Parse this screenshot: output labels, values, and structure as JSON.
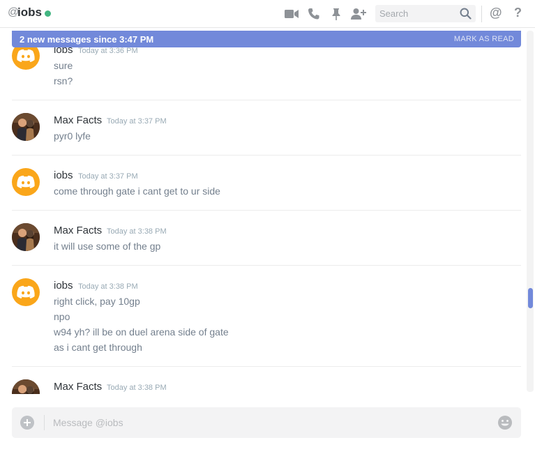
{
  "header": {
    "at_symbol": "@",
    "channel_name": "iobs",
    "status_color": "#43b581",
    "icons": [
      "video-call-icon",
      "voice-call-icon",
      "pin-icon",
      "add-friend-icon",
      "mention-icon",
      "help-icon"
    ],
    "mention_label": "@",
    "help_label": "?"
  },
  "search": {
    "placeholder": "Search"
  },
  "new_messages_bar": {
    "text": "2 new messages since 3:47 PM",
    "action": "MARK AS READ",
    "color": "#7289da"
  },
  "messages": [
    {
      "author": "iobs",
      "timestamp": "Today at 3:36 PM",
      "lines": [
        "sure",
        "rsn?"
      ]
    },
    {
      "author": "Max Facts",
      "timestamp": "Today at 3:37 PM",
      "lines": [
        "pyr0 lyfe"
      ]
    },
    {
      "author": "iobs",
      "timestamp": "Today at 3:37 PM",
      "lines": [
        "come through gate i cant get to ur side"
      ]
    },
    {
      "author": "Max Facts",
      "timestamp": "Today at 3:38 PM",
      "lines": [
        "it will use some of the gp"
      ]
    },
    {
      "author": "iobs",
      "timestamp": "Today at 3:38 PM",
      "lines": [
        "right click, pay 10gp",
        "npo",
        "w94 yh? ill be on duel arena side of gate",
        "as i cant get through"
      ]
    },
    {
      "author": "Max Facts",
      "timestamp": "Today at 3:38 PM",
      "lines": []
    }
  ],
  "composer": {
    "placeholder": "Message @iobs"
  },
  "colors": {
    "accent": "#7289da",
    "discord_avatar": "#faa61a",
    "online": "#43b581"
  }
}
